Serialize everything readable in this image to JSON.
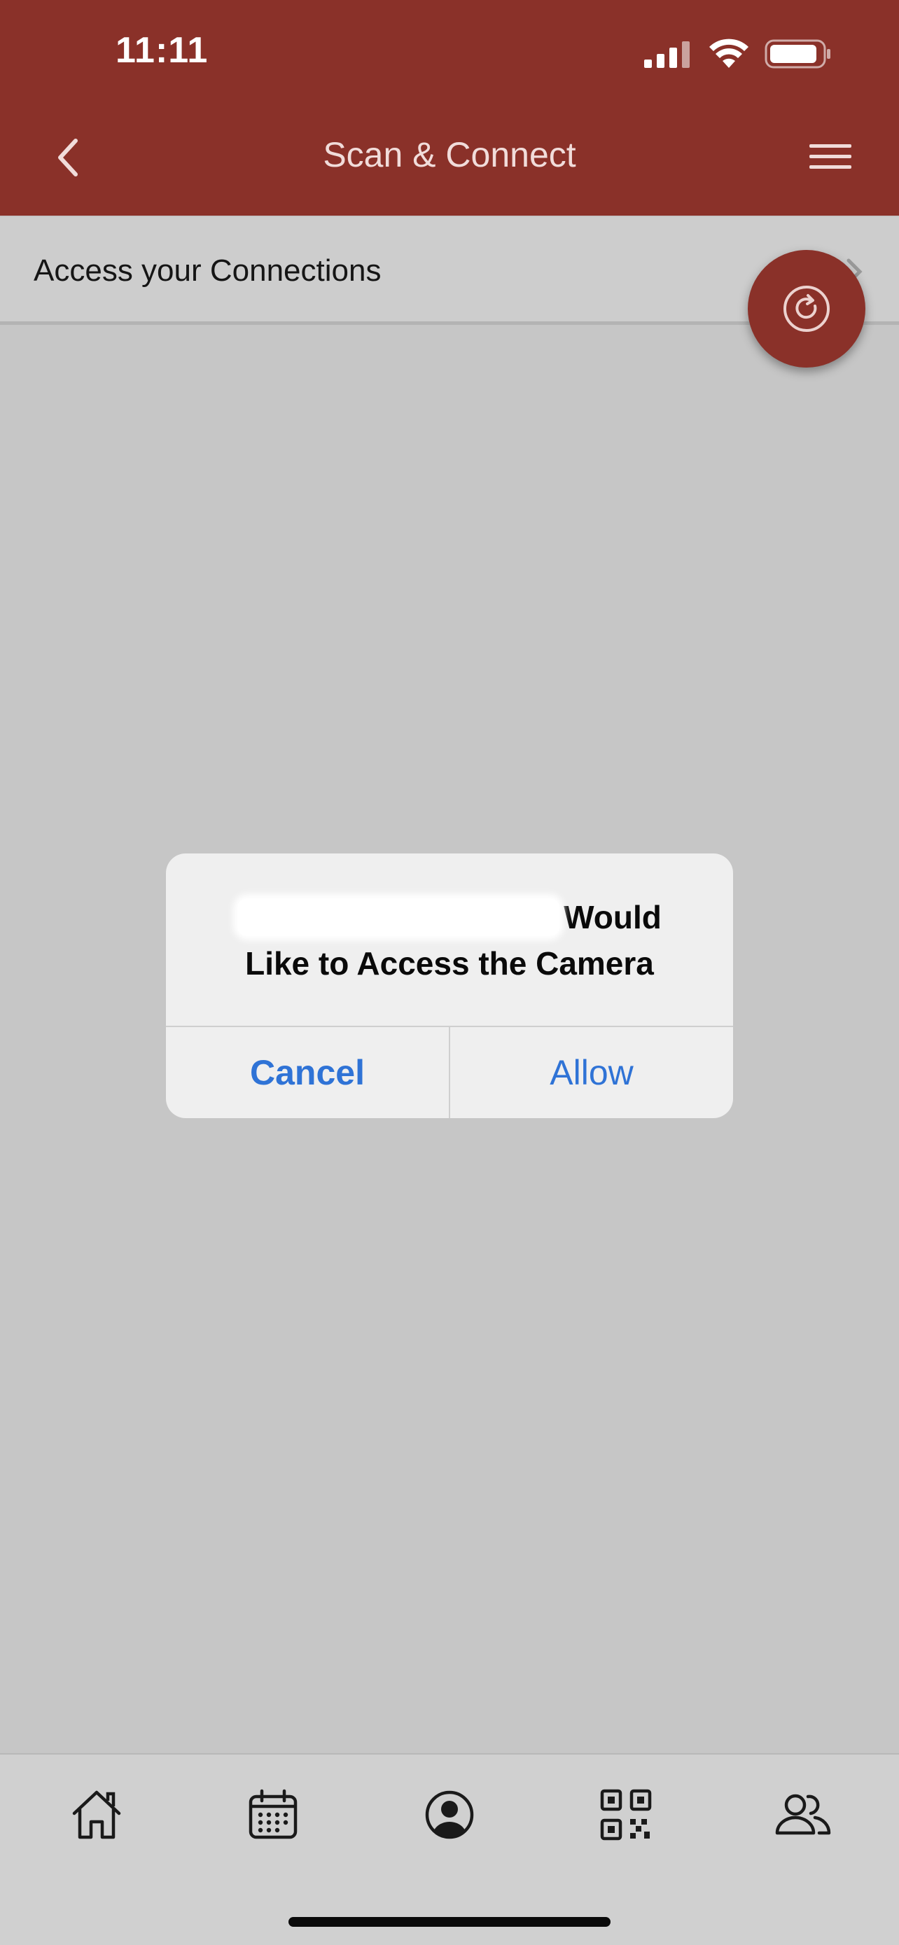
{
  "status_bar": {
    "time": "11:11"
  },
  "header": {
    "title": "Scan & Connect",
    "back_icon": "chevron-left-icon",
    "menu_icon": "hamburger-menu-icon"
  },
  "connections": {
    "label": "Access your Connections"
  },
  "fab": {
    "icon": "refresh-icon"
  },
  "dialog": {
    "title_line1_suffix": "Would",
    "title_line2": "Like to Access the Camera",
    "cancel_label": "Cancel",
    "allow_label": "Allow"
  },
  "tabbar": {
    "items": [
      {
        "icon": "home-icon"
      },
      {
        "icon": "calendar-icon"
      },
      {
        "icon": "profile-icon"
      },
      {
        "icon": "qr-code-icon"
      },
      {
        "icon": "people-icon"
      }
    ]
  },
  "colors": {
    "brand": "#8a3129",
    "link": "#2f73d6",
    "backdrop": "#c6c6c6"
  }
}
